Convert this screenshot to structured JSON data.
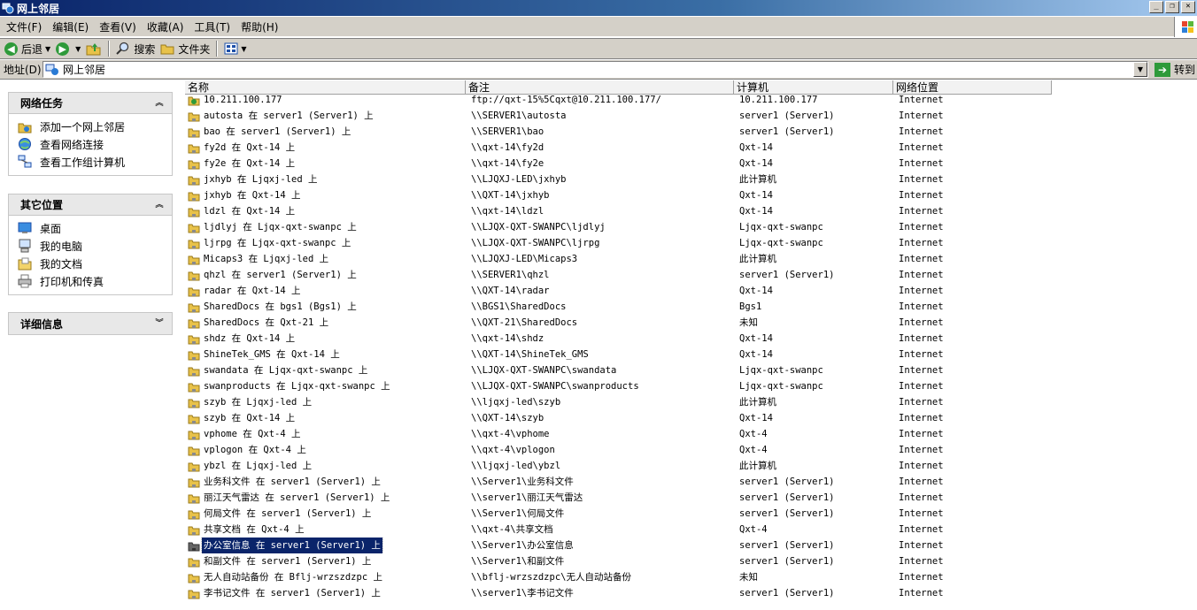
{
  "window": {
    "title": "网上邻居"
  },
  "menu": [
    "文件(F)",
    "编辑(E)",
    "查看(V)",
    "收藏(A)",
    "工具(T)",
    "帮助(H)"
  ],
  "toolbar": {
    "back": "后退",
    "search": "搜索",
    "folders": "文件夹"
  },
  "address": {
    "label": "地址(D)",
    "value": "网上邻居",
    "go": "转到"
  },
  "tasks": {
    "network_tasks": {
      "title": "网络任务",
      "items": [
        "添加一个网上邻居",
        "查看网络连接",
        "查看工作组计算机"
      ]
    },
    "other_places": {
      "title": "其它位置",
      "items": [
        "桌面",
        "我的电脑",
        "我的文档",
        "打印机和传真"
      ]
    },
    "details": {
      "title": "详细信息"
    }
  },
  "columns": [
    "名称",
    "备注",
    "计算机",
    "网络位置"
  ],
  "rows": [
    {
      "name": "10.211.100.177",
      "note": "ftp://qxt-15%5Cqxt@10.211.100.177/",
      "computer": "10.211.100.177",
      "location": "Internet",
      "ftp": true
    },
    {
      "name": "autosta 在 server1 (Server1) 上",
      "note": "\\\\SERVER1\\autosta",
      "computer": "server1 (Server1)",
      "location": "Internet"
    },
    {
      "name": "bao 在 server1 (Server1) 上",
      "note": "\\\\SERVER1\\bao",
      "computer": "server1 (Server1)",
      "location": "Internet"
    },
    {
      "name": "fy2d 在 Qxt-14 上",
      "note": "\\\\qxt-14\\fy2d",
      "computer": "Qxt-14",
      "location": "Internet"
    },
    {
      "name": "fy2e 在 Qxt-14 上",
      "note": "\\\\qxt-14\\fy2e",
      "computer": "Qxt-14",
      "location": "Internet"
    },
    {
      "name": "jxhyb 在 Ljqxj-led 上",
      "note": "\\\\LJQXJ-LED\\jxhyb",
      "computer": "此计算机",
      "location": "Internet"
    },
    {
      "name": "jxhyb 在 Qxt-14 上",
      "note": "\\\\QXT-14\\jxhyb",
      "computer": "Qxt-14",
      "location": "Internet"
    },
    {
      "name": "ldzl 在 Qxt-14 上",
      "note": "\\\\qxt-14\\ldzl",
      "computer": "Qxt-14",
      "location": "Internet"
    },
    {
      "name": "ljdlyj 在 Ljqx-qxt-swanpc 上",
      "note": "\\\\LJQX-QXT-SWANPC\\ljdlyj",
      "computer": "Ljqx-qxt-swanpc",
      "location": "Internet"
    },
    {
      "name": "ljrpg 在 Ljqx-qxt-swanpc 上",
      "note": "\\\\LJQX-QXT-SWANPC\\ljrpg",
      "computer": "Ljqx-qxt-swanpc",
      "location": "Internet"
    },
    {
      "name": "Micaps3 在 Ljqxj-led 上",
      "note": "\\\\LJQXJ-LED\\Micaps3",
      "computer": "此计算机",
      "location": "Internet"
    },
    {
      "name": "qhzl 在 server1 (Server1) 上",
      "note": "\\\\SERVER1\\qhzl",
      "computer": "server1 (Server1)",
      "location": "Internet"
    },
    {
      "name": "radar 在 Qxt-14 上",
      "note": "\\\\QXT-14\\radar",
      "computer": "Qxt-14",
      "location": "Internet"
    },
    {
      "name": "SharedDocs 在 bgs1 (Bgs1) 上",
      "note": "\\\\BGS1\\SharedDocs",
      "computer": "Bgs1",
      "location": "Internet"
    },
    {
      "name": "SharedDocs 在 Qxt-21 上",
      "note": "\\\\QXT-21\\SharedDocs",
      "computer": "未知",
      "location": "Internet"
    },
    {
      "name": "shdz 在 Qxt-14 上",
      "note": "\\\\qxt-14\\shdz",
      "computer": "Qxt-14",
      "location": "Internet"
    },
    {
      "name": "ShineTek_GMS 在 Qxt-14 上",
      "note": "\\\\QXT-14\\ShineTek_GMS",
      "computer": "Qxt-14",
      "location": "Internet"
    },
    {
      "name": "swandata 在 Ljqx-qxt-swanpc 上",
      "note": "\\\\LJQX-QXT-SWANPC\\swandata",
      "computer": "Ljqx-qxt-swanpc",
      "location": "Internet"
    },
    {
      "name": "swanproducts 在 Ljqx-qxt-swanpc 上",
      "note": "\\\\LJQX-QXT-SWANPC\\swanproducts",
      "computer": "Ljqx-qxt-swanpc",
      "location": "Internet"
    },
    {
      "name": "szyb 在 Ljqxj-led 上",
      "note": "\\\\ljqxj-led\\szyb",
      "computer": "此计算机",
      "location": "Internet"
    },
    {
      "name": "szyb 在 Qxt-14 上",
      "note": "\\\\QXT-14\\szyb",
      "computer": "Qxt-14",
      "location": "Internet"
    },
    {
      "name": "vphome 在 Qxt-4 上",
      "note": "\\\\qxt-4\\vphome",
      "computer": "Qxt-4",
      "location": "Internet"
    },
    {
      "name": "vplogon 在 Qxt-4 上",
      "note": "\\\\qxt-4\\vplogon",
      "computer": "Qxt-4",
      "location": "Internet"
    },
    {
      "name": "ybzl 在 Ljqxj-led 上",
      "note": "\\\\ljqxj-led\\ybzl",
      "computer": "此计算机",
      "location": "Internet"
    },
    {
      "name": "业务科文件 在 server1 (Server1) 上",
      "note": "\\\\Server1\\业务科文件",
      "computer": "server1 (Server1)",
      "location": "Internet"
    },
    {
      "name": "丽江天气雷达 在 server1 (Server1) 上",
      "note": "\\\\server1\\丽江天气雷达",
      "computer": "server1 (Server1)",
      "location": "Internet"
    },
    {
      "name": "何局文件 在 server1 (Server1) 上",
      "note": "\\\\Server1\\何局文件",
      "computer": "server1 (Server1)",
      "location": "Internet"
    },
    {
      "name": "共享文档 在 Qxt-4 上",
      "note": "\\\\qxt-4\\共享文档",
      "computer": "Qxt-4",
      "location": "Internet"
    },
    {
      "name": "办公室信息 在 server1 (Server1) 上",
      "note": "\\\\Server1\\办公室信息",
      "computer": "server1 (Server1)",
      "location": "Internet",
      "selected": true
    },
    {
      "name": "和副文件 在 server1 (Server1) 上",
      "note": "\\\\Server1\\和副文件",
      "computer": "server1 (Server1)",
      "location": "Internet"
    },
    {
      "name": "无人自动站备份 在 Bflj-wrzszdzpc 上",
      "note": "\\\\bflj-wrzszdzpc\\无人自动站备份",
      "computer": "未知",
      "location": "Internet"
    },
    {
      "name": "李书记文件 在 server1 (Server1) 上",
      "note": "\\\\server1\\李书记文件",
      "computer": "server1 (Server1)",
      "location": "Internet"
    }
  ],
  "colors": {
    "titlebar": "#0a246a",
    "selection": "#0a246a",
    "chrome": "#d4d0c8",
    "folder": "#e8c24a"
  }
}
